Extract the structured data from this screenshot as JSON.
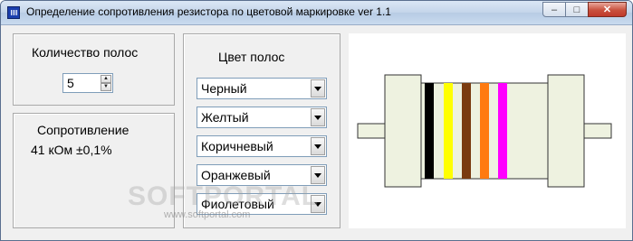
{
  "window": {
    "title": "Определение сопротивления резистора по цветовой маркировке ver 1.1",
    "min_symbol": "–",
    "max_symbol": "□",
    "close_symbol": "✕"
  },
  "bands_count": {
    "label": "Количество полос",
    "value": "5"
  },
  "resistance": {
    "label": "Сопротивление",
    "value": "41 кОм ±0,1%"
  },
  "band_colors": {
    "label": "Цвет полос",
    "items": [
      {
        "name": "Черный",
        "hex": "#000000"
      },
      {
        "name": "Желтый",
        "hex": "#ffff00"
      },
      {
        "name": "Коричневый",
        "hex": "#7a3b10"
      },
      {
        "name": "Оранжевый",
        "hex": "#ff7a10"
      },
      {
        "name": "Фиолетовый",
        "hex": "#ff00ff"
      }
    ]
  },
  "resistor": {
    "body_color": "#eef2e0",
    "outline_color": "#333333"
  },
  "watermark": {
    "text": "SOFTPORTAL",
    "url": "www.softportal.com"
  }
}
